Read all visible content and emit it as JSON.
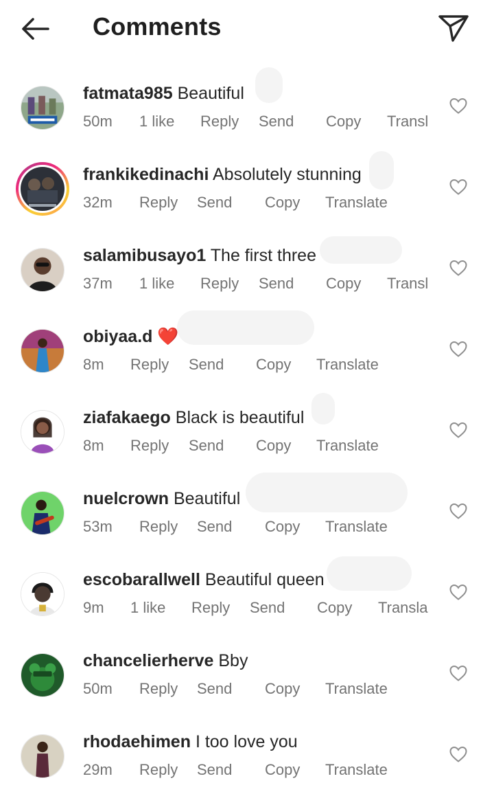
{
  "header": {
    "title": "Comments",
    "back_icon": "arrow-left-icon",
    "send_icon": "paper-plane-icon"
  },
  "colors": {
    "text_primary": "#262626",
    "text_secondary": "#737373",
    "heart_red": "#e0243a"
  },
  "comments": [
    {
      "username": "fatmata985",
      "text": "Beautiful",
      "time": "50m",
      "likes": "1 like",
      "reply": "Reply",
      "send": "Send",
      "copy": "Copy",
      "translate": "Transl"
    },
    {
      "username": "frankikedinachi",
      "text": "Absolutely stunning",
      "time": "32m",
      "reply": "Reply",
      "send": "Send",
      "copy": "Copy",
      "translate": "Translate"
    },
    {
      "username": "salamibusayo1",
      "text": "The first three",
      "time": "37m",
      "likes": "1 like",
      "reply": "Reply",
      "send": "Send",
      "copy": "Copy",
      "translate": "Transl"
    },
    {
      "username": "obiyaa.d",
      "text": "❤️",
      "time": "8m",
      "reply": "Reply",
      "send": "Send",
      "copy": "Copy",
      "translate": "Translate"
    },
    {
      "username": "ziafakaego",
      "text": "Black is beautiful",
      "time": "8m",
      "reply": "Reply",
      "send": "Send",
      "copy": "Copy",
      "translate": "Translate"
    },
    {
      "username": "nuelcrown",
      "text": "Beautiful",
      "time": "53m",
      "reply": "Reply",
      "send": "Send",
      "copy": "Copy",
      "translate": "Translate"
    },
    {
      "username": "escobarallwell",
      "text": "Beautiful queen",
      "time": "9m",
      "likes": "1 like",
      "reply": "Reply",
      "send": "Send",
      "copy": "Copy",
      "translate": "Transla"
    },
    {
      "username": "chancelierherve",
      "text": "Bby",
      "time": "50m",
      "reply": "Reply",
      "send": "Send",
      "copy": "Copy",
      "translate": "Translate"
    },
    {
      "username": "rhodaehimen",
      "text": "I too love you",
      "time": "29m",
      "reply": "Reply",
      "send": "Send",
      "copy": "Copy",
      "translate": "Translate"
    }
  ]
}
